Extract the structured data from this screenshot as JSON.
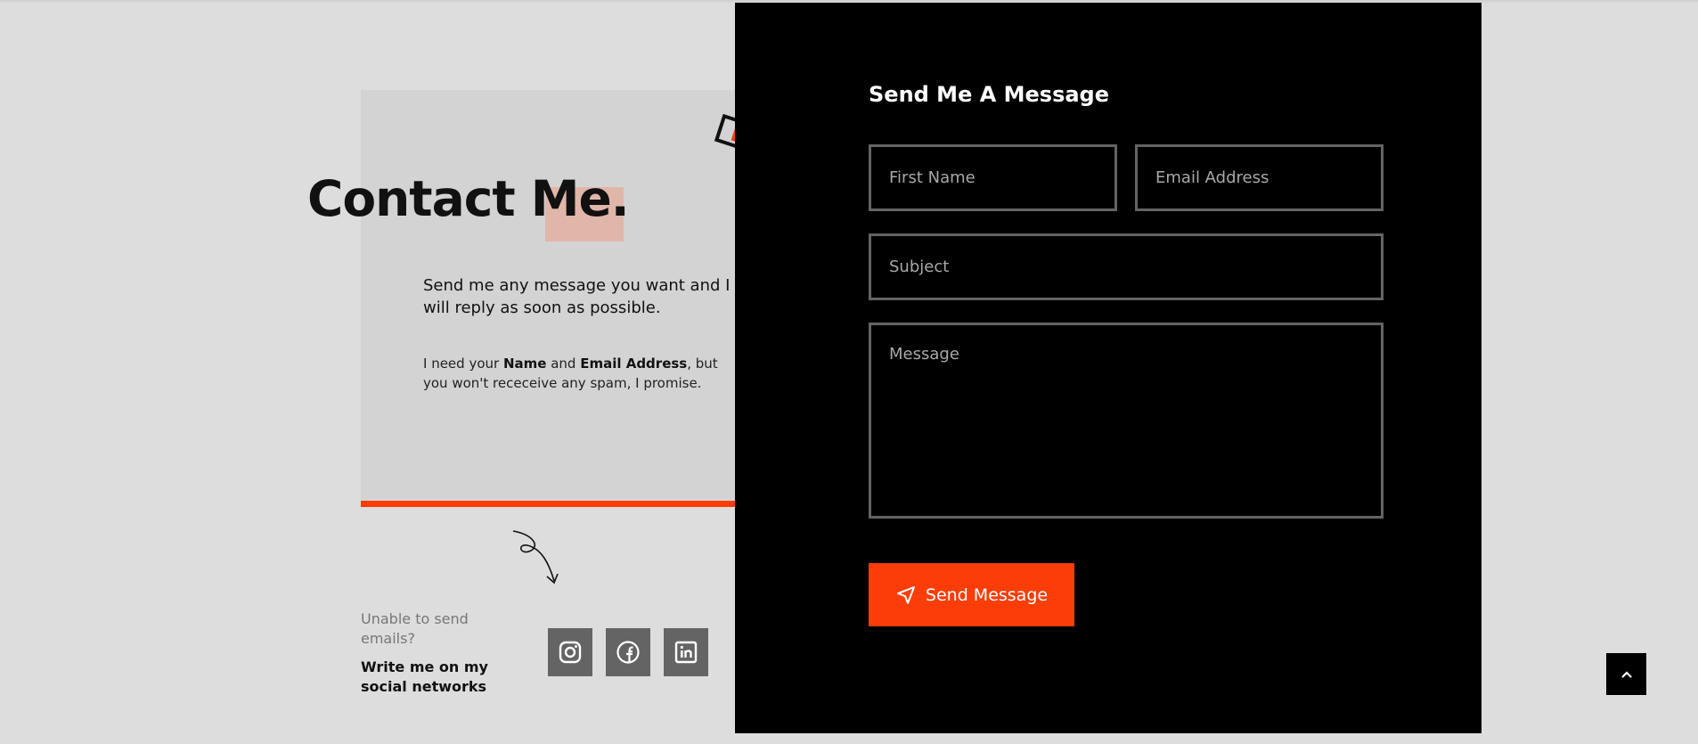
{
  "contact": {
    "title": "Contact Me.",
    "intro": "Send me any message you want and I will reply as soon as possible.",
    "note_prefix": "I need your ",
    "note_name": "Name",
    "note_and": " and ",
    "note_email": "Email Address",
    "note_suffix": ", but you won't receceive any spam, I promise.",
    "unable": "Unable to send emails?",
    "write_me": "Write me on my social networks"
  },
  "social": {
    "icons": [
      "instagram-icon",
      "facebook-icon",
      "linkedin-icon"
    ]
  },
  "form": {
    "title": "Send Me A Message",
    "first_name_placeholder": "First Name",
    "email_placeholder": "Email Address",
    "subject_placeholder": "Subject",
    "message_placeholder": "Message",
    "send_label": "Send Message"
  },
  "colors": {
    "accent": "#fc3d07",
    "highlight": "#e0b6a9",
    "panel": "#000000",
    "background": "#dddddd"
  }
}
